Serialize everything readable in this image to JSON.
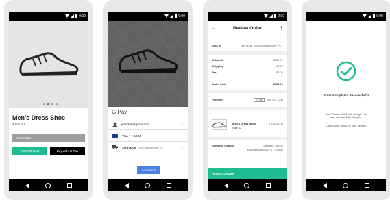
{
  "status_time": "9:00",
  "phone1": {
    "product_title": "Men's Dress Shoe",
    "price": "$125.00",
    "select_size": "Select Size",
    "add_to_bag": "ADD TO BAG",
    "buy_with": "Buy with",
    "gpay": "G Pay"
  },
  "phone2": {
    "gpay_title": "G Pay",
    "email": "johndoe@gmail.com",
    "card": "Visa •••• 1234",
    "ship_name": "John Doe",
    "ship_address": "1600 Amphitheatre Pk...",
    "continue": "CONTINUE"
  },
  "phone3": {
    "title": "Review Order",
    "ship_to_label": "Ship to",
    "ship_to_value": "John Doe, 1600 Amphitheatre Pk...",
    "subtotal_label": "Subtotal",
    "subtotal_value": "$125.00",
    "shipping_label": "Shipping",
    "shipping_value": "$5.00",
    "tax_label": "Tax",
    "tax_value": "$0.00",
    "order_total_label": "Order total",
    "order_total_value": "$130.00",
    "pay_with_label": "Pay With",
    "pay_with_badge": "G Pay",
    "pay_with_card": "Visa •••• 1234",
    "item_name": "Men's Dress Shoe",
    "item_size": "Size 12",
    "item_qty_price": "1 x $125.00",
    "shipping_options_label": "Shipping Options",
    "shipping_option_value": "Standard - $5.00",
    "shipping_option_sub": "Estimated delivery 3 - 5 Days",
    "place_order": "PLACE ORDER"
  },
  "phone4": {
    "success_title": "Order Completed Successfully!",
    "charged_line1": "Your Visa ••• 1234 with Google Pay",
    "charged_line2": "was successfully charged.",
    "email_note": "Check your email for your receipt."
  },
  "colors": {
    "accent_green": "#1ebc8e",
    "continue_blue": "#4a7fe6"
  }
}
